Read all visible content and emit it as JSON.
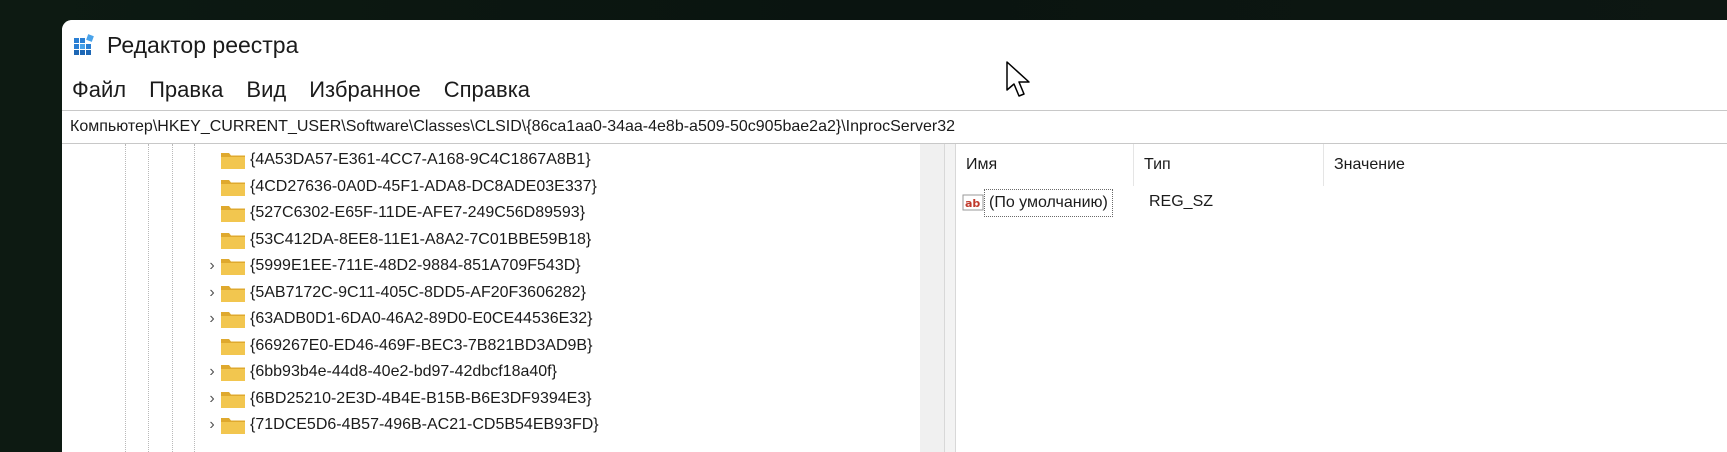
{
  "window": {
    "title": "Редактор реестра"
  },
  "menu": [
    {
      "label": "Файл"
    },
    {
      "label": "Правка"
    },
    {
      "label": "Вид"
    },
    {
      "label": "Избранное"
    },
    {
      "label": "Справка"
    }
  ],
  "address": "Компьютер\\HKEY_CURRENT_USER\\Software\\Classes\\CLSID\\{86ca1aa0-34aa-4e8b-a509-50c905bae2a2}\\InprocServer32",
  "tree": {
    "items": [
      {
        "label": "{4A53DA57-E361-4CC7-A168-9C4C1867A8B1}",
        "expander": ""
      },
      {
        "label": "{4CD27636-0A0D-45F1-ADA8-DC8ADE03E337}",
        "expander": ""
      },
      {
        "label": "{527C6302-E65F-11DE-AFE7-249C56D89593}",
        "expander": ""
      },
      {
        "label": "{53C412DA-8EE8-11E1-A8A2-7C01BBE59B18}",
        "expander": ""
      },
      {
        "label": "{5999E1EE-711E-48D2-9884-851A709F543D}",
        "expander": "›"
      },
      {
        "label": "{5AB7172C-9C11-405C-8DD5-AF20F3606282}",
        "expander": "›"
      },
      {
        "label": "{63ADB0D1-6DA0-46A2-89D0-E0CE44536E32}",
        "expander": "›"
      },
      {
        "label": "{669267E0-ED46-469F-BEC3-7B821BD3AD9B}",
        "expander": ""
      },
      {
        "label": "{6bb93b4e-44d8-40e2-bd97-42dbcf18a40f}",
        "expander": "›"
      },
      {
        "label": "{6BD25210-2E3D-4B4E-B15B-B6E3DF9394E3}",
        "expander": "›"
      },
      {
        "label": "{71DCE5D6-4B57-496B-AC21-CD5B54EB93FD}",
        "expander": "›"
      }
    ]
  },
  "values": {
    "columns": {
      "name": "Имя",
      "type": "Тип",
      "data": "Значение"
    },
    "rows": [
      {
        "name": "(По умолчанию)",
        "type": "REG_SZ",
        "icon": "string-value-icon"
      }
    ]
  },
  "colors": {
    "folder": "#f2c64f",
    "folder_dark": "#dfa92e",
    "value_icon": "#c0392b"
  }
}
